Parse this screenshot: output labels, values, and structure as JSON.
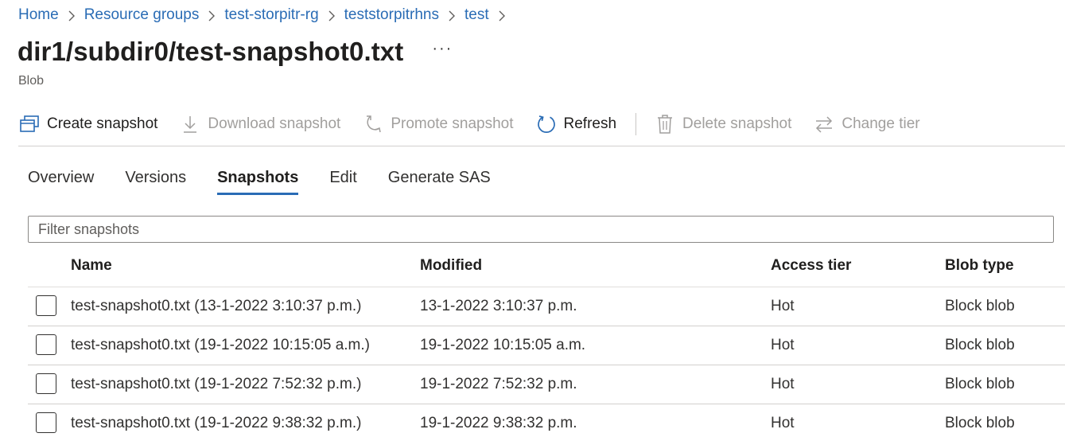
{
  "breadcrumb": [
    {
      "label": "Home"
    },
    {
      "label": "Resource groups"
    },
    {
      "label": "test-storpitr-rg"
    },
    {
      "label": "teststorpitrhns"
    },
    {
      "label": "test"
    }
  ],
  "header": {
    "title": "dir1/subdir0/test-snapshot0.txt",
    "more": "···",
    "subtitle": "Blob"
  },
  "toolbar": {
    "create": "Create snapshot",
    "download": "Download snapshot",
    "promote": "Promote snapshot",
    "refresh": "Refresh",
    "delete": "Delete snapshot",
    "change_tier": "Change tier"
  },
  "tabs": [
    {
      "label": "Overview"
    },
    {
      "label": "Versions"
    },
    {
      "label": "Snapshots",
      "active": true
    },
    {
      "label": "Edit"
    },
    {
      "label": "Generate SAS"
    }
  ],
  "filter": {
    "placeholder": "Filter snapshots",
    "value": ""
  },
  "table": {
    "columns": {
      "name": "Name",
      "modified": "Modified",
      "access_tier": "Access tier",
      "blob_type": "Blob type"
    },
    "rows": [
      {
        "name": "test-snapshot0.txt (13-1-2022 3:10:37 p.m.)",
        "modified": "13-1-2022 3:10:37 p.m.",
        "access_tier": "Hot",
        "blob_type": "Block blob"
      },
      {
        "name": "test-snapshot0.txt (19-1-2022 10:15:05 a.m.)",
        "modified": "19-1-2022 10:15:05 a.m.",
        "access_tier": "Hot",
        "blob_type": "Block blob"
      },
      {
        "name": "test-snapshot0.txt (19-1-2022 7:52:32 p.m.)",
        "modified": "19-1-2022 7:52:32 p.m.",
        "access_tier": "Hot",
        "blob_type": "Block blob"
      },
      {
        "name": "test-snapshot0.txt (19-1-2022 9:38:32 p.m.)",
        "modified": "19-1-2022 9:38:32 p.m.",
        "access_tier": "Hot",
        "blob_type": "Block blob"
      }
    ]
  },
  "colors": {
    "link": "#2a6cb5",
    "accent": "#2a6cb5",
    "disabled": "#a19f9d"
  },
  "icons": {
    "create": "snapshot-stack-icon",
    "download": "download-icon",
    "promote": "promote-icon",
    "refresh": "refresh-icon",
    "delete": "trash-icon",
    "change_tier": "swap-arrows-icon",
    "breadcrumb_separator": "chevron-right-icon"
  }
}
